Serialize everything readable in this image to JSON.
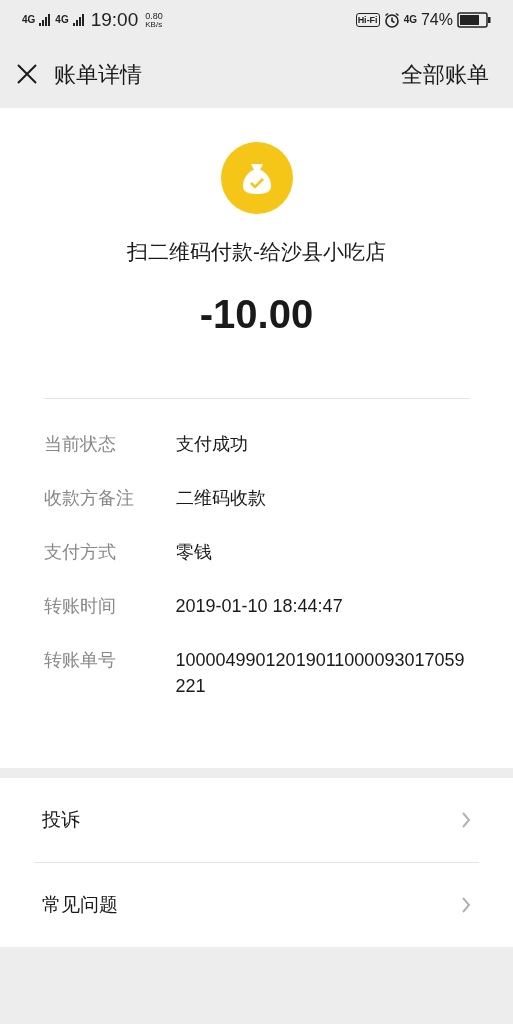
{
  "status_bar": {
    "signal_1": "4G",
    "signal_2": "4G",
    "time": "19:00",
    "speed_value": "0.80",
    "speed_unit": "KB/s",
    "hifi": "Hi-Fi",
    "network": "4G",
    "battery": "74%"
  },
  "nav": {
    "title": "账单详情",
    "right_link": "全部账单"
  },
  "summary": {
    "title": "扫二维码付款-给沙县小吃店",
    "amount": "-10.00"
  },
  "details": [
    {
      "label": "当前状态",
      "value": "支付成功"
    },
    {
      "label": "收款方备注",
      "value": "二维码收款"
    },
    {
      "label": "支付方式",
      "value": "零钱"
    },
    {
      "label": "转账时间",
      "value": "2019-01-10 18:44:47"
    },
    {
      "label": "转账单号",
      "value": "10000499012019011000093017059221"
    }
  ],
  "links": [
    {
      "label": "投诉"
    },
    {
      "label": "常见问题"
    }
  ]
}
